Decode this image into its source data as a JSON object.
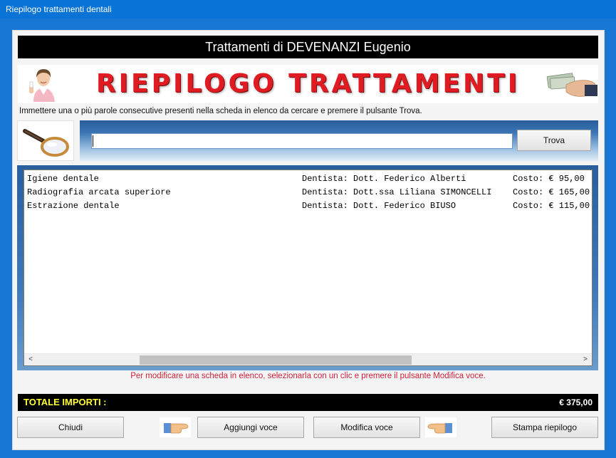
{
  "window": {
    "title": "Riepilogo trattamenti dentali"
  },
  "header": {
    "title": "Trattamenti di DEVENANZI Eugenio"
  },
  "banner": {
    "title": "RIEPILOGO TRATTAMENTI",
    "left_icon": "dentist-woman-icon",
    "right_icon": "money-hand-icon"
  },
  "instruction": "Immettere una o più parole consecutive presenti nella scheda in elenco da cercare e premere il pulsante Trova.",
  "search": {
    "icon": "magnifier-icon",
    "value": "",
    "button_label": "Trova"
  },
  "list": {
    "rows": [
      {
        "treatment": "Igiene dentale",
        "dentist": "Dentista: Dott. Federico Alberti",
        "cost": "Costo: € 95,00"
      },
      {
        "treatment": "Radiografia arcata superiore",
        "dentist": "Dentista: Dott.ssa Liliana SIMONCELLI",
        "cost": "Costo: € 165,00"
      },
      {
        "treatment": "Estrazione dentale",
        "dentist": "Dentista: Dott. Federico BIUSO",
        "cost": "Costo: € 115,00"
      }
    ],
    "scroll_left": "<",
    "scroll_right": ">"
  },
  "hint": "Per modificare una scheda in elenco, selezionarla con un clic e premere il pulsante Modifica voce.",
  "total": {
    "label": "TOTALE IMPORTI :",
    "value": "€ 375,00"
  },
  "buttons": {
    "close": "Chiudi",
    "add": "Aggiungi voce",
    "edit": "Modifica voce",
    "print": "Stampa riepilogo"
  },
  "colors": {
    "titlebar": "#0a73d6",
    "banner_text": "#e11b22",
    "total_label": "#ffff33",
    "hint": "#d0223a"
  }
}
